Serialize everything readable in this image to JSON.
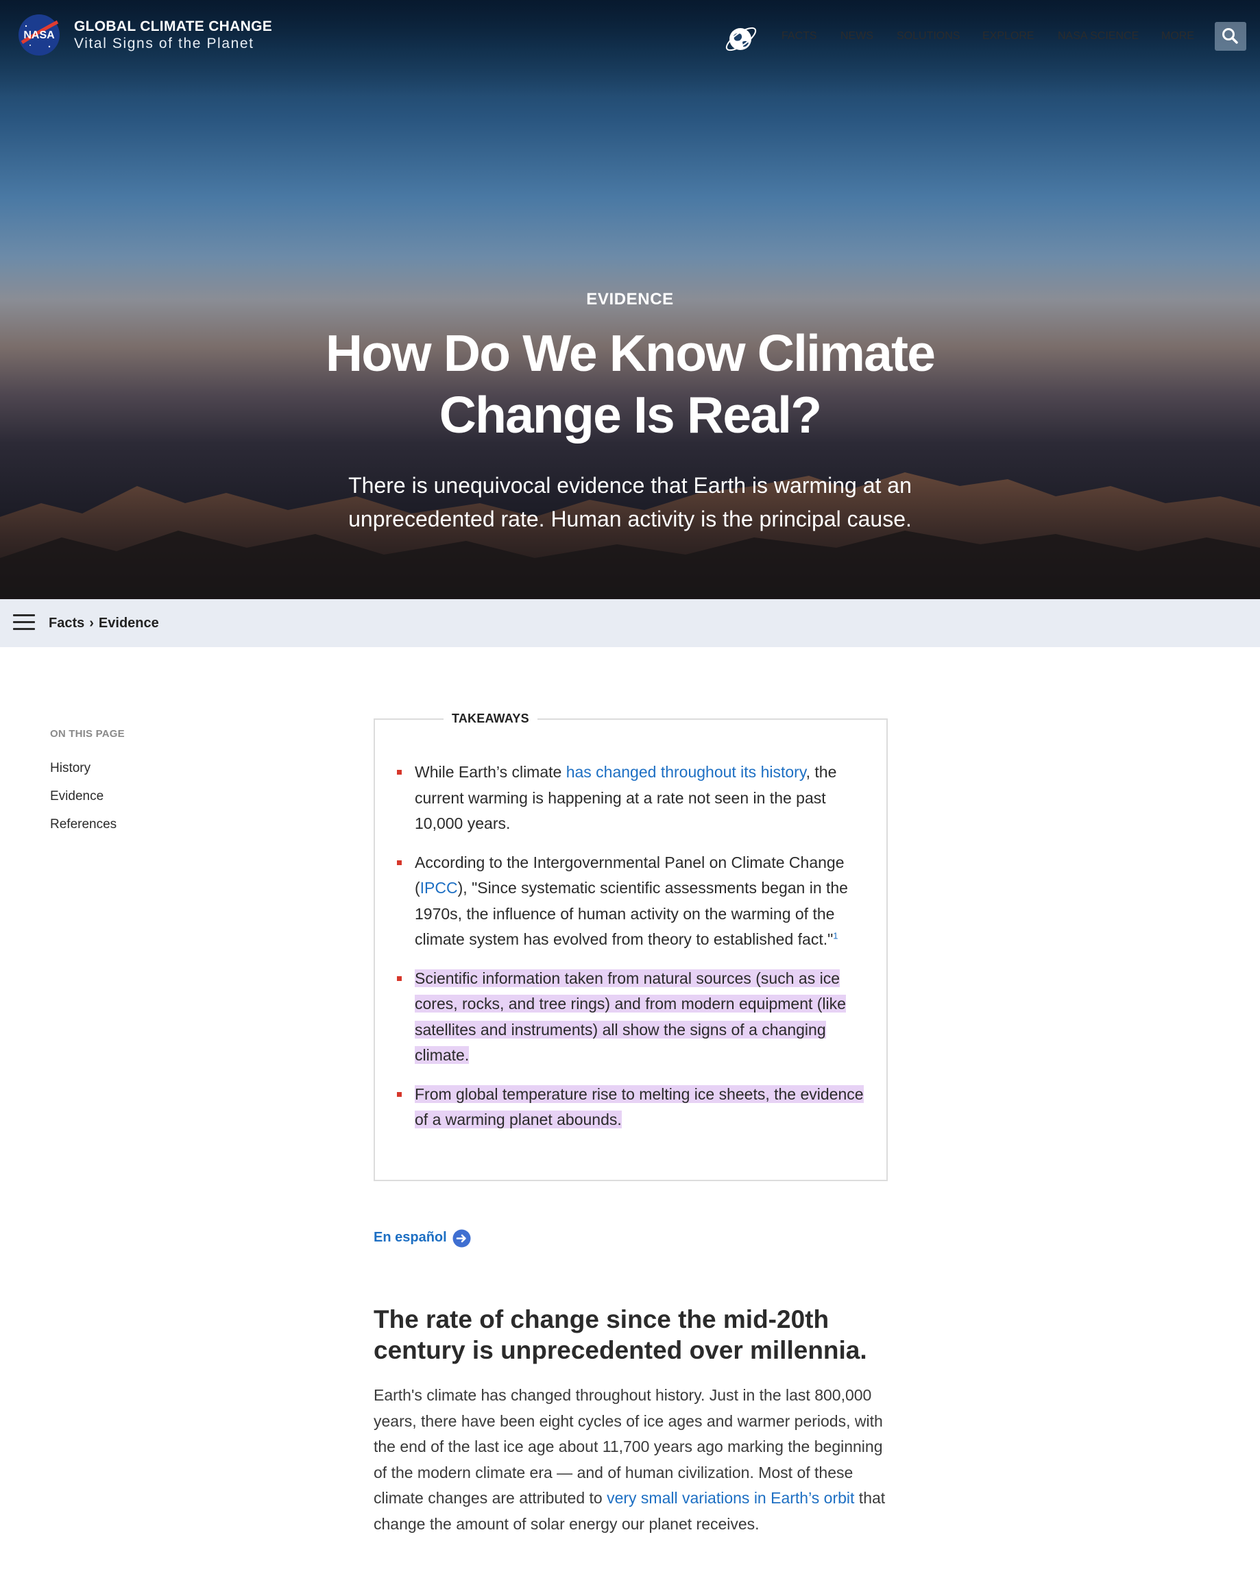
{
  "header": {
    "brand_title": "GLOBAL CLIMATE CHANGE",
    "brand_subtitle": "Vital Signs of the Planet",
    "nav": [
      "FACTS",
      "NEWS",
      "SOLUTIONS",
      "EXPLORE",
      "NASA SCIENCE",
      "MORE"
    ]
  },
  "hero": {
    "eyebrow": "EVIDENCE",
    "title_line1": "How Do We Know Climate",
    "title_line2": "Change Is Real?",
    "subtitle_line1": "There is unequivocal evidence that Earth is warming at an",
    "subtitle_line2": "unprecedented rate. Human activity is the principal cause."
  },
  "breadcrumb": {
    "items": [
      "Facts",
      "Evidence"
    ],
    "separator": "›"
  },
  "on_this_page": {
    "label": "ON THIS PAGE",
    "items": [
      "History",
      "Evidence",
      "References"
    ]
  },
  "takeaways": {
    "title": "TAKEAWAYS",
    "item1": {
      "pre": "While Earth’s climate ",
      "link": "has changed throughout its history",
      "post": ", the current warming is happening at a rate not seen in the past 10,000 years."
    },
    "item2": {
      "pre": "According to the Intergovernmental Panel on Climate Change (",
      "link": "IPCC",
      "post": "), \"Since systematic scientific assessments began in the 1970s, the influence of human activity on the warming of the climate system has evolved from theory to established fact.\"",
      "footnote": "1"
    },
    "item3": "Scientific information taken from natural sources (such as ice cores, rocks, and tree rings) and from modern equipment (like satellites and instruments) all show the signs of a changing climate.",
    "item4": "From global temperature rise to melting ice sheets, the evidence of a warming planet abounds."
  },
  "espanol": {
    "label": "En español"
  },
  "section": {
    "heading": "The rate of change since the mid-20th century is unprecedented over millennia.",
    "para_pre": "Earth's climate has changed throughout history. Just in the last 800,000 years, there have been eight cycles of ice ages and warmer periods, with the end of the last ice age about 11,700 years ago marking the beginning of the modern climate era — and of human civilization. Most of these climate changes are attributed to ",
    "para_link": "very small variations in Earth’s orbit",
    "para_post": " that change the amount of solar energy our planet receives."
  },
  "colors": {
    "link": "#1d6fc3",
    "highlight": "#e7d2f5",
    "bullet": "#d6372b",
    "crumb_bg": "#e8ecf3"
  },
  "icons": [
    "nasa-logo",
    "globe-orbit-icon",
    "search-icon",
    "hamburger-menu-icon",
    "arrow-right-circle-icon"
  ]
}
